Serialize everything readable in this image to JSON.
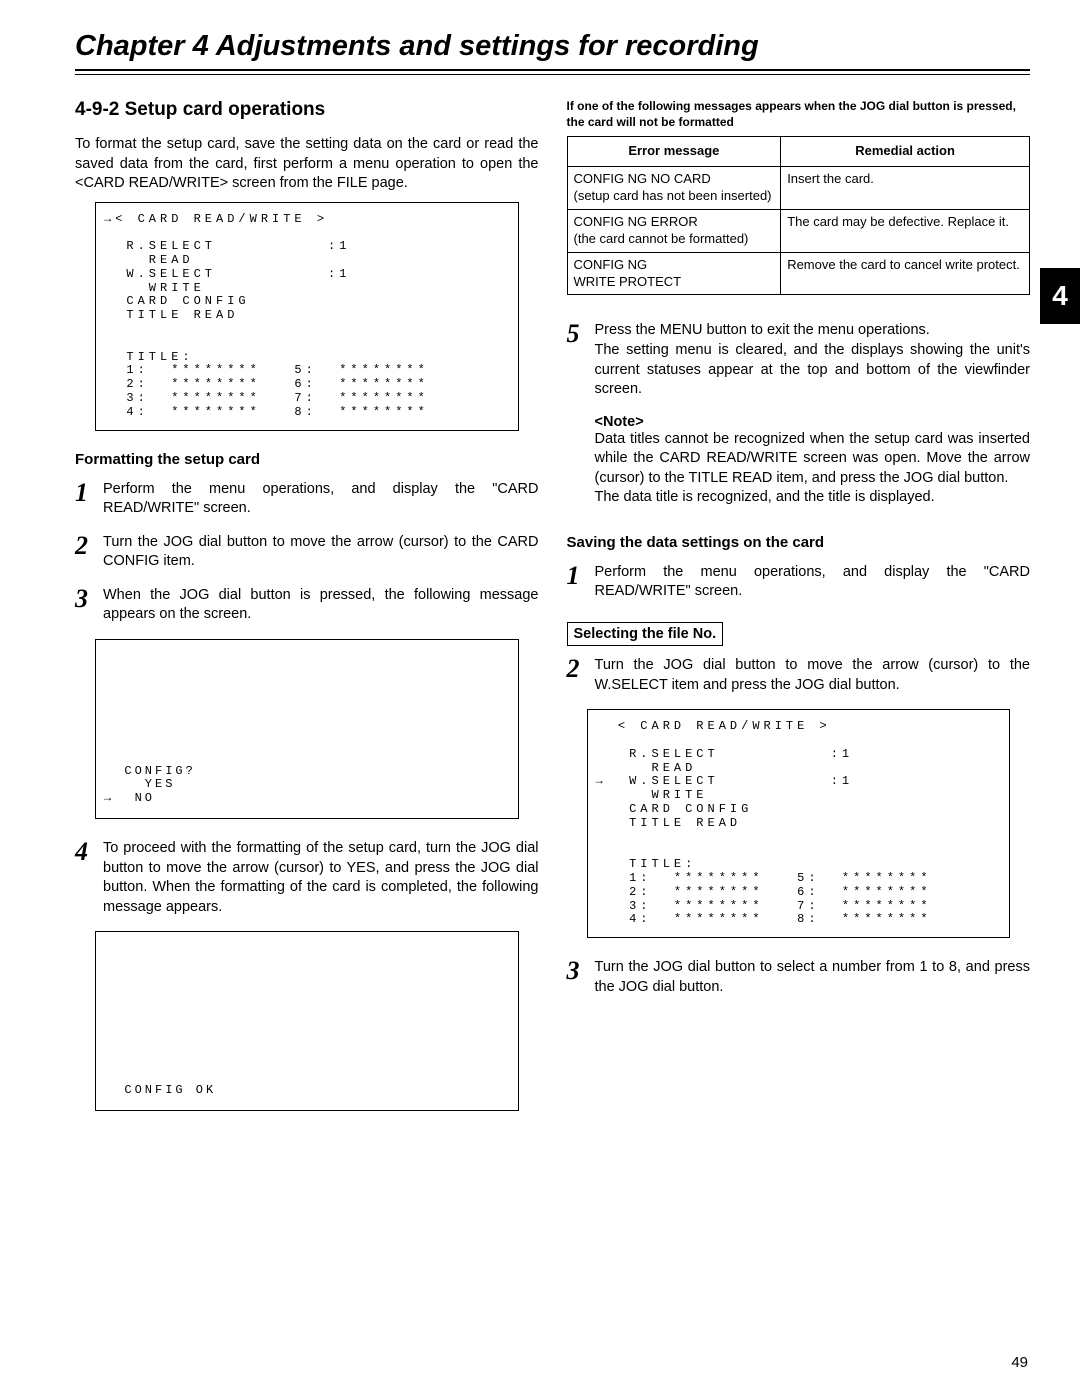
{
  "chapter_title": "Chapter 4  Adjustments and settings for recording",
  "tab_number": "4",
  "page_number": "49",
  "left": {
    "section_heading": "4-9-2 Setup card operations",
    "intro": "To format the setup card, save the setting data on the card or read the saved data from the card, first perform a menu operation to open the <CARD READ/WRITE> screen from the FILE page.",
    "screen1": "→< CARD READ/WRITE >\n\n  R.SELECT          :1\n    READ\n  W.SELECT          :1\n    WRITE\n  CARD CONFIG\n  TITLE READ\n\n\n  TITLE:\n  1:  ********   5:  ********\n  2:  ********   6:  ********\n  3:  ********   7:  ********\n  4:  ********   8:  ********",
    "sub1": "Formatting the setup card",
    "step1": "Perform the menu operations, and display the \"CARD READ/WRITE\" screen.",
    "step2": "Turn the JOG dial button to move the arrow (cursor) to the CARD CONFIG item.",
    "step3": "When the JOG dial button is pressed, the following message appears on the screen.",
    "screen2": "\n\n\n\n\n\n\n  CONFIG?\n    YES\n→  NO",
    "step4": "To proceed with the formatting of the setup card, turn the JOG dial button to move the arrow (cursor) to YES, and press the JOG dial button.  When the formatting of the card is completed, the following message appears.",
    "screen3": "\n\n\n\n\n\n\n\n  CONFIG OK"
  },
  "right": {
    "err_intro": "If one of the following messages appears when the JOG dial button is pressed, the card will not be formatted",
    "err_header1": "Error message",
    "err_header2": "Remedial action",
    "err_rows": [
      [
        "CONFIG NG NO CARD\n(setup card has not been inserted)",
        "Insert the card."
      ],
      [
        "CONFIG NG ERROR\n(the card cannot be formatted)",
        "The card may be defective. Replace it."
      ],
      [
        "CONFIG NG\nWRITE PROTECT",
        "Remove the card to cancel write protect."
      ]
    ],
    "step5": "Press the MENU button to exit the menu operations.\nThe setting menu is cleared, and the displays showing the unit's current statuses appear at the top and bottom of the viewfinder screen.",
    "note_label": "<Note>",
    "note_body": "Data titles cannot be recognized when the setup card was inserted while the CARD READ/WRITE screen was open. Move the arrow (cursor) to the TITLE READ item, and press the JOG dial button.\nThe data title is recognized, and the title is displayed.",
    "sub2": "Saving the data settings on the card",
    "step1b": "Perform the menu operations, and display the \"CARD READ/WRITE\" screen.",
    "boxed": "Selecting the file No.",
    "step2b": "Turn the JOG dial button to move the arrow (cursor) to the W.SELECT item and press the JOG dial button.",
    "screen4": "  < CARD READ/WRITE >\n\n   R.SELECT          :1\n     READ\n→  W.SELECT          :1\n     WRITE\n   CARD CONFIG\n   TITLE READ\n\n\n   TITLE:\n   1:  ********   5:  ********\n   2:  ********   6:  ********\n   3:  ********   7:  ********\n   4:  ********   8:  ********",
    "step3b": "Turn the JOG dial button to select a number from 1 to 8, and press the JOG dial button."
  }
}
